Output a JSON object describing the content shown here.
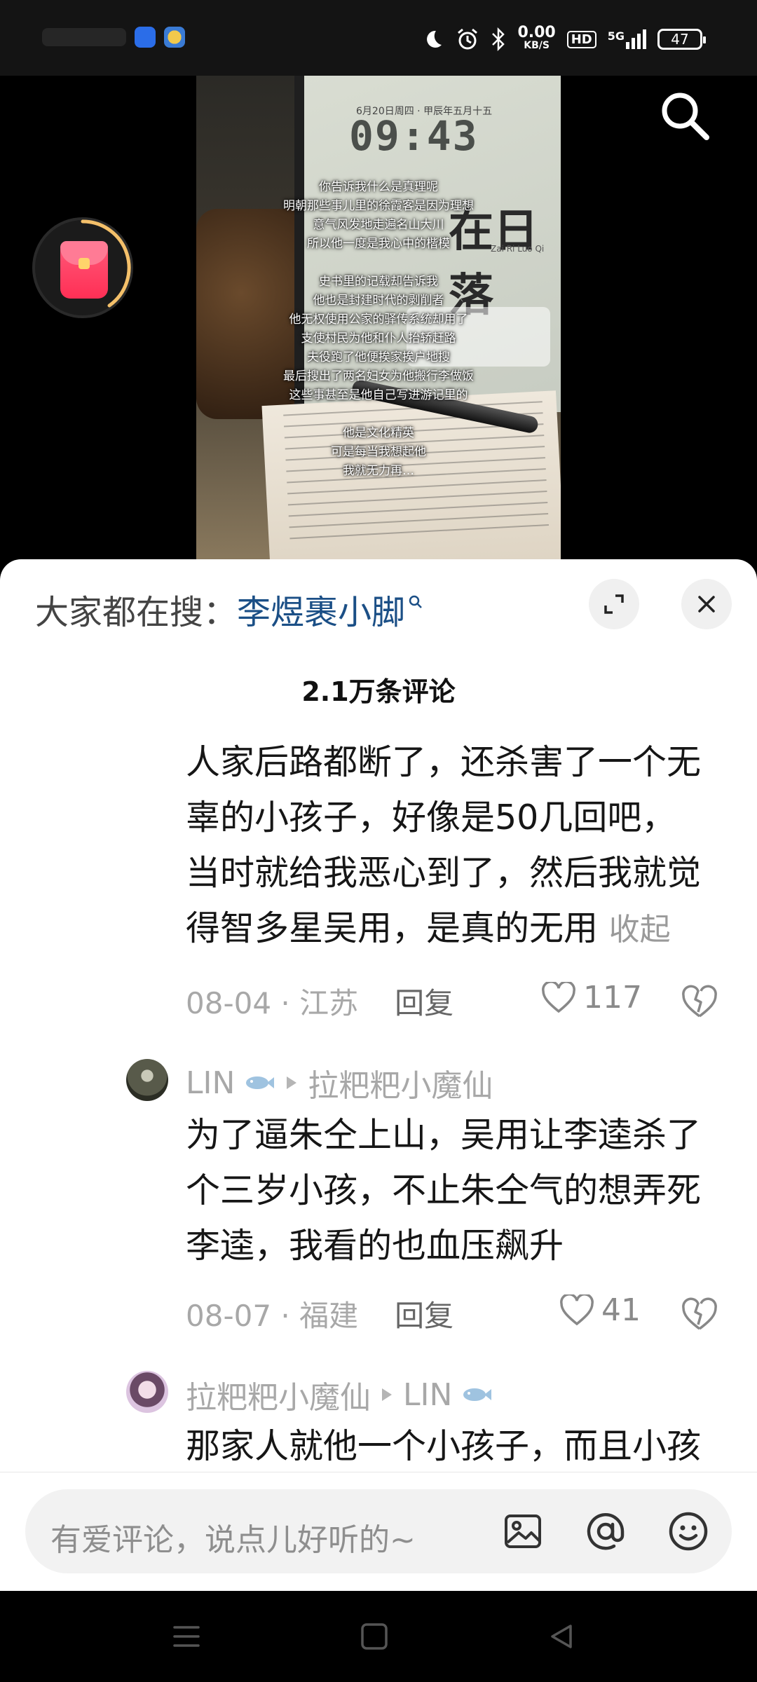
{
  "status_bar": {
    "net_speed_value": "0.00",
    "net_speed_unit": "KB/S",
    "hd_label": "HD",
    "network_label": "5G",
    "battery": "47",
    "icons": [
      "moon-icon",
      "alarm-icon",
      "bluetooth-icon",
      "signal-icon",
      "battery-icon"
    ]
  },
  "video": {
    "tablet_date": "6月20日周四 · 甲辰年五月十五",
    "tablet_time": "09:43",
    "tablet_title": "在日落",
    "tablet_subtitle": "Zai Ri Luo Qi",
    "lyrics": [
      "你告诉我什么是真理呢",
      "明朝那些事儿里的徐霞客是因为理想",
      "意气风发地走遍名山大川",
      "所以他一度是我心中的楷模",
      "",
      "史书里的记载却告诉我",
      "他也是封建时代的剥削者",
      "他无权使用公家的驿传系统却用了",
      "支使村民为他和仆人抬轿赶路",
      "夫役跑了他便挨家挨户地搜",
      "最后搜出了两名妇女为他搬行李做饭",
      "这些事甚至是他自己写进游记里的",
      "",
      "他是文化精英",
      "可是每当我想起他",
      "我就无力再…"
    ]
  },
  "sheet": {
    "trend_prefix": "大家都在搜：",
    "trend_keyword": "李煜裹小脚",
    "comment_count": "2.1万条评论",
    "comments": [
      {
        "lines": [
          "人家后路都断了，还杀害了一个无",
          "辜的小孩子，好像是50几回吧，",
          "当时就给我恶心到了，然后我就觉",
          "得智多星吴用，是真的无用"
        ],
        "fold_label": "收起",
        "meta": "08-04 · 江苏",
        "reply_label": "回复",
        "likes": "117"
      },
      {
        "author": "LIN",
        "reply_to": "拉粑粑小魔仙",
        "lines": [
          "为了逼朱仝上山，吴用让李逵杀了",
          "个三岁小孩，不止朱仝气的想弄死",
          "李逵，我看的也血压飙升"
        ],
        "meta": "08-07 · 福建",
        "reply_label": "回复",
        "likes": "41"
      },
      {
        "author": "拉粑粑小魔仙",
        "reply_to": "LIN",
        "lines": [
          "那家人就他一个小孩子，而且小孩"
        ]
      }
    ]
  },
  "input": {
    "placeholder": "有爱评论，说点儿好听的~",
    "icons": [
      "image-icon",
      "at-icon",
      "emoji-icon"
    ]
  },
  "navbar": {
    "icons": [
      "menu-icon",
      "home-icon",
      "back-icon"
    ]
  },
  "colors": {
    "trend_keyword": "#1b4f86",
    "text_primary": "#161616",
    "text_secondary": "#a8a8a8",
    "redpacket": "#ff2f55"
  }
}
